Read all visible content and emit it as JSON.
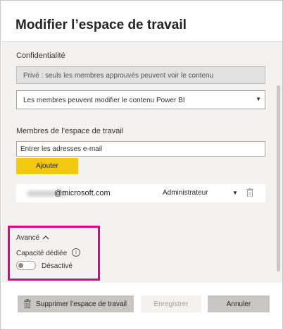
{
  "dialog": {
    "title": "Modifier l’espace de travail"
  },
  "privacy": {
    "label": "Confidentialité",
    "value": "Privé : seuls les membres approuvés peuvent voir le contenu"
  },
  "edit_permission": {
    "selected": "Les membres peuvent modifier le contenu Power BI"
  },
  "members": {
    "label": "Membres de l’espace de travail",
    "email_placeholder": "Entrer les adresses e-mail",
    "add_label": "Ajouter",
    "list": [
      {
        "email": "@microsoft.com",
        "role": "Administrateur"
      }
    ]
  },
  "advanced": {
    "label": "Avancé",
    "capacity_label": "Capacité dédiée",
    "info_glyph": "i",
    "toggle_state": "Désactivé"
  },
  "footer": {
    "delete_label": "Supprimer l’espace de travail",
    "save_label": "Enregistrer",
    "cancel_label": "Annuler"
  },
  "colors": {
    "add_button": "#f2c811",
    "highlight": "#e3008c",
    "panel_background": "#f3f2f1"
  }
}
